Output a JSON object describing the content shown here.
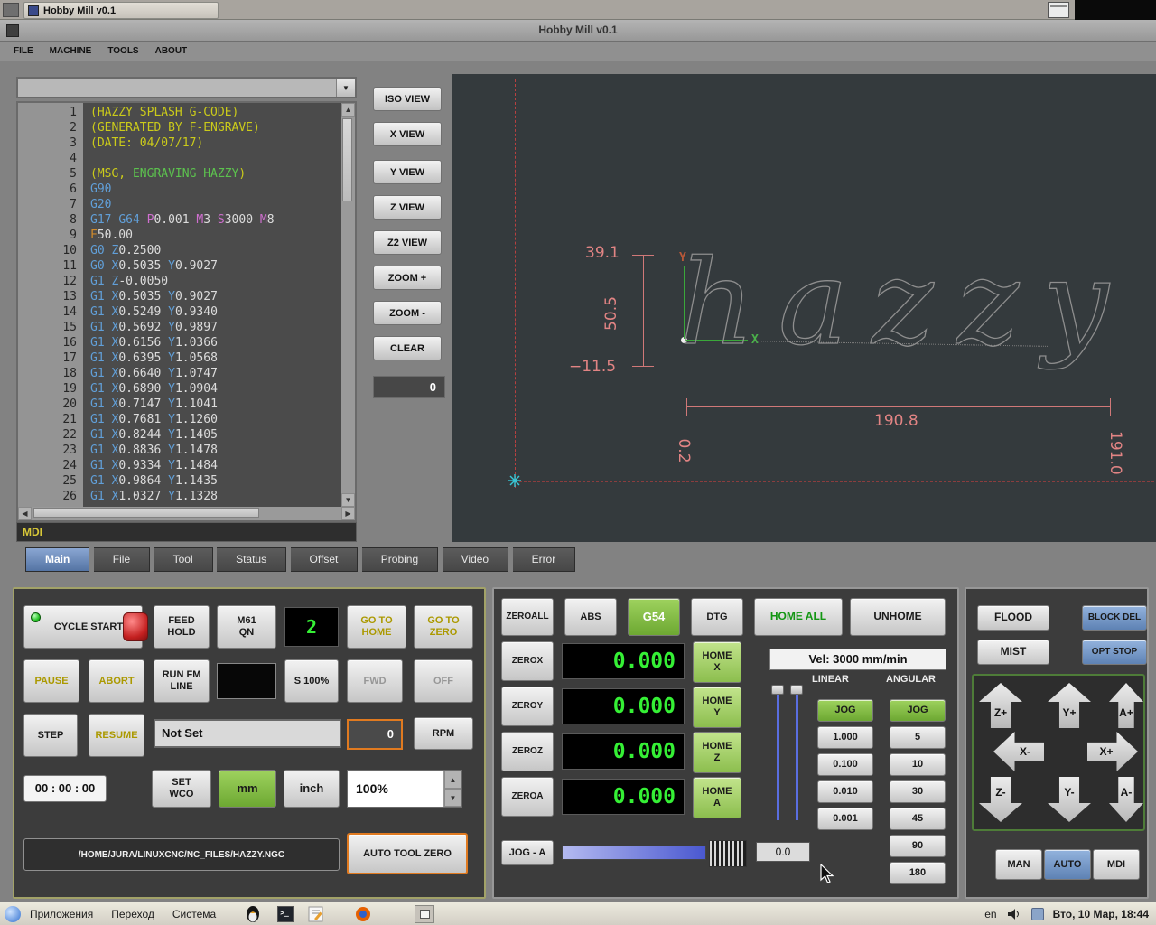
{
  "top_panel": {
    "task_button": "Hobby Mill v0.1"
  },
  "titlebar": {
    "title": "Hobby Mill v0.1"
  },
  "menubar": {
    "items": [
      "FILE",
      "MACHINE",
      "TOOLS",
      "ABOUT"
    ]
  },
  "editor": {
    "mdi_label": "MDI",
    "lines": [
      "(HAZZY SPLASH G-CODE)",
      "(GENERATED BY F-ENGRAVE)",
      "(DATE: 04/07/17)",
      "",
      "(MSG, ENGRAVING HAZZY)",
      "G90",
      "G20",
      "G17 G64 P0.001 M3 S3000 M8",
      "F50.00",
      "G0 Z0.2500",
      "G0 X0.5035 Y0.9027",
      "G1 Z-0.0050",
      "G1 X0.5035 Y0.9027",
      "G1 X0.5249 Y0.9340",
      "G1 X0.5692 Y0.9897",
      "G1 X0.6156 Y1.0366",
      "G1 X0.6395 Y1.0568",
      "G1 X0.6640 Y1.0747",
      "G1 X0.6890 Y1.0904",
      "G1 X0.7147 Y1.1041",
      "G1 X0.7681 Y1.1260",
      "G1 X0.8244 Y1.1405",
      "G1 X0.8836 Y1.1478",
      "G1 X0.9334 Y1.1484",
      "G1 X0.9864 Y1.1435",
      "G1 X1.0327 Y1.1328"
    ]
  },
  "view_panel": {
    "buttons": [
      "ISO VIEW",
      "X VIEW",
      "Y VIEW",
      "Z VIEW",
      "Z2 VIEW",
      "ZOOM +",
      "ZOOM -",
      "CLEAR"
    ],
    "counter": "0"
  },
  "preview": {
    "word": "hazzy",
    "axis_x": "X",
    "axis_y": "Y",
    "dim_top": "39.1",
    "dim_height": "50.5",
    "dim_bottom": "−11.5",
    "dim_width": "190.8",
    "dim_x_start": "0.2",
    "dim_x_end": "191.0"
  },
  "tabs": {
    "items": [
      "Main",
      "File",
      "Tool",
      "Status",
      "Offset",
      "Probing",
      "Video",
      "Error"
    ]
  },
  "control": {
    "cycle_start": "CYCLE START",
    "feed_hold": "FEED\nHOLD",
    "m61": "M61\nQN",
    "tool_display": "2",
    "goto_home": "GO TO\nHOME",
    "goto_zero": "GO TO\nZERO",
    "pause": "PAUSE",
    "abort": "ABORT",
    "run_fm_line": "RUN FM\nLINE",
    "spindle_override": "S 100%",
    "fwd": "FWD",
    "off": "OFF",
    "step": "STEP",
    "resume": "RESUME",
    "tool_desc": "Not Set",
    "tool_number": "0",
    "rpm": "RPM",
    "timer": "00 : 00 : 00",
    "set_wco": "SET\nWCO",
    "mm": "mm",
    "inch": "inch",
    "feed_override": "100%",
    "file_path": "/HOME/JURA/LINUXCNC/NC_FILES/HAZZY.NGC",
    "auto_tool_zero": "AUTO TOOL ZERO"
  },
  "dro": {
    "zero_all": "ZEROALL",
    "abs": "ABS",
    "g54": "G54",
    "dtg": "DTG",
    "home_all": "HOME ALL",
    "unhome": "UNHOME",
    "rows": [
      {
        "zero": "ZEROX",
        "value": "0.000",
        "home": "HOME\nX"
      },
      {
        "zero": "ZEROY",
        "value": "0.000",
        "home": "HOME\nY"
      },
      {
        "zero": "ZEROZ",
        "value": "0.000",
        "home": "HOME\nZ"
      },
      {
        "zero": "ZEROA",
        "value": "0.000",
        "home": "HOME\nA"
      }
    ],
    "velocity": "Vel: 3000 mm/min",
    "linear_label": "LINEAR",
    "angular_label": "ANGULAR",
    "jog_label": "JOG",
    "linear_increments": [
      "1.000",
      "0.100",
      "0.010",
      "0.001"
    ],
    "angular_increments": [
      "5",
      "10",
      "30",
      "45",
      "90",
      "180"
    ],
    "jog_axis": "JOG - A",
    "jog_value": "0.0"
  },
  "right_panel": {
    "flood": "FLOOD",
    "block_del": "BLOCK DEL",
    "mist": "MIST",
    "opt_stop": "OPT STOP",
    "arrows": {
      "z_plus": "Z+",
      "y_plus": "Y+",
      "a_plus": "A+",
      "x_minus": "X-",
      "x_plus": "X+",
      "z_minus": "Z-",
      "y_minus": "Y-",
      "a_minus": "A-"
    },
    "modes": [
      "MAN",
      "AUTO",
      "MDI"
    ]
  },
  "taskbar": {
    "menus": [
      "Приложения",
      "Переход",
      "Система"
    ],
    "layout": "en",
    "clock": "Вто, 10 Мар, 18:44"
  },
  "colors": {
    "accent_green": "#76b041",
    "accent_blue": "#6d92c4",
    "dro_green": "#35f035",
    "dim_pink": "#e28484"
  }
}
